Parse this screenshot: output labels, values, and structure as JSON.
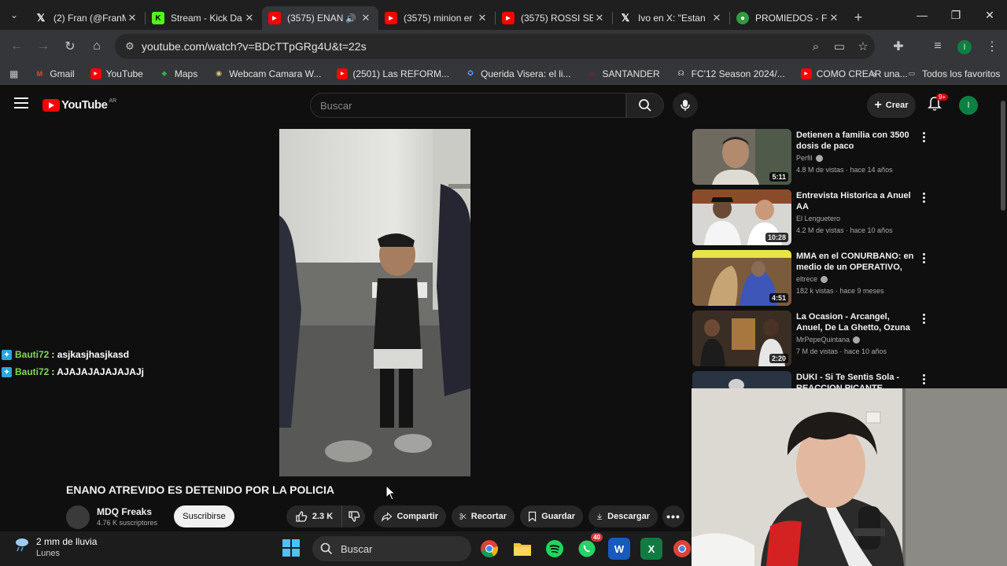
{
  "browser": {
    "tabs": [
      {
        "title": "(2) Fran (@FranM",
        "favicon": "x-icon",
        "active": false
      },
      {
        "title": "Stream - Kick Da",
        "favicon": "kick-icon",
        "active": false
      },
      {
        "title": "(3575) ENAN",
        "favicon": "youtube-icon",
        "active": true,
        "audio": true
      },
      {
        "title": "(3575) minion er",
        "favicon": "youtube-icon",
        "active": false
      },
      {
        "title": "(3575) ROSSI SE",
        "favicon": "youtube-icon",
        "active": false
      },
      {
        "title": "Ivo en X: \"Estan",
        "favicon": "x-icon",
        "active": false
      },
      {
        "title": "PROMIEDOS - F",
        "favicon": "promiedos-icon",
        "active": false
      }
    ],
    "url": "youtube.com/watch?v=BDcTTpGRg4U&t=22s",
    "profile_initial": "I",
    "bookmarks": [
      {
        "label": "Gmail",
        "icon": "gmail-icon"
      },
      {
        "label": "YouTube",
        "icon": "youtube-icon"
      },
      {
        "label": "Maps",
        "icon": "maps-icon"
      },
      {
        "label": "Webcam Camara W...",
        "icon": "webcam-icon"
      },
      {
        "label": "(2501) Las REFORM...",
        "icon": "youtube-icon"
      },
      {
        "label": "Querida Visera: el li...",
        "icon": "site-icon"
      },
      {
        "label": "SANTANDER",
        "icon": "santander-icon"
      },
      {
        "label": "FC'12 Season 2024/...",
        "icon": "fc-icon"
      },
      {
        "label": "COMO CREAR una...",
        "icon": "youtube-icon"
      }
    ],
    "all_bookmarks": "Todos los favoritos"
  },
  "youtube": {
    "logo_text": "YouTube",
    "country_code": "AR",
    "search_placeholder": "Buscar",
    "create_label": "Crear",
    "notif_badge": "9+",
    "avatar_initial": "I",
    "video_title": "ENANO ATREVIDO ES DETENIDO POR LA POLICIA",
    "channel_name": "MDQ Freaks",
    "channel_subs": "4.76 K suscriptores",
    "subscribe_label": "Suscribirse",
    "like_count": "2.3 K",
    "share_label": "Compartir",
    "clip_label": "Recortar",
    "save_label": "Guardar",
    "download_label": "Descargar",
    "chat": [
      {
        "user": "Bauti72",
        "message": ": asjkasjhasjkasd"
      },
      {
        "user": "Bauti72",
        "message": ": AJAJAJAJAJAJAJj"
      }
    ],
    "recommended": [
      {
        "title": "Detienen a familia con 3500 dosis de paco",
        "channel": "Perfil",
        "verified": true,
        "meta": "4.8 M de vistas · hace 14 años",
        "duration": "5:11"
      },
      {
        "title": "Entrevista Historica a Anuel AA",
        "channel": "El Lenguetero",
        "verified": false,
        "meta": "4.2 M de vistas · hace 10 años",
        "duration": "10:28"
      },
      {
        "title": "MMA en el CONURBANO: en medio de un OPERATIVO, DOS ...",
        "channel": "eltrece",
        "verified": true,
        "meta": "182 k vistas · hace 9 meses",
        "duration": "4:51"
      },
      {
        "title": "La Ocasion - Arcangel, Anuel, De La Ghetto, Ozuna [Making ...",
        "channel": "MrPepeQuintana",
        "verified": true,
        "meta": "7 M de vistas · hace 10 años",
        "duration": "2:20"
      },
      {
        "title": "DUKI - Si Te Sentis Sola - REACCION PICANTE",
        "channel": "",
        "verified": false,
        "meta": "",
        "duration": ""
      }
    ]
  },
  "taskbar": {
    "weather_text": "2 mm de lluvia",
    "weather_day": "Lunes",
    "search_label": "Buscar",
    "whatsapp_badge": "40"
  }
}
